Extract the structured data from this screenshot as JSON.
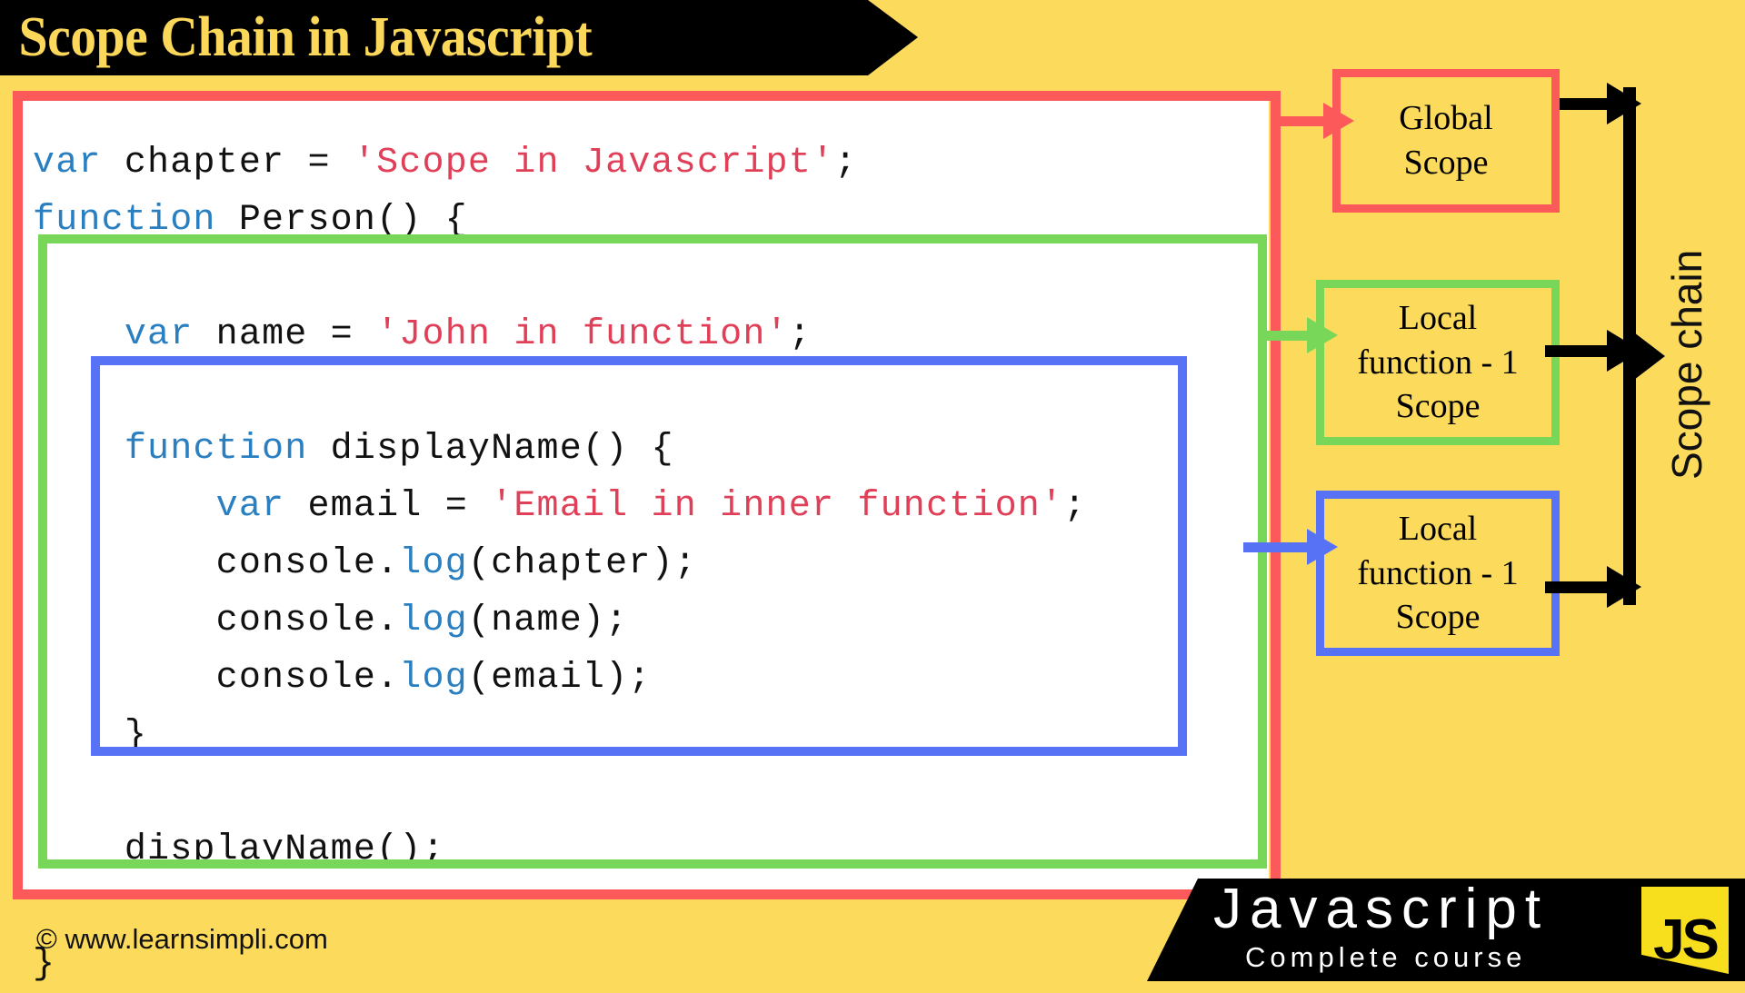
{
  "title": {
    "text": "Scope Chain in Javascript"
  },
  "code": {
    "lines": [
      [
        {
          "t": "var",
          "c": "kw"
        },
        {
          "t": " chapter = ",
          "c": "plain"
        },
        {
          "t": "'Scope in Javascript'",
          "c": "str"
        },
        {
          "t": ";",
          "c": "plain"
        }
      ],
      [
        {
          "t": "function",
          "c": "kw"
        },
        {
          "t": " Person() {",
          "c": "plain"
        }
      ],
      [
        {
          "t": "",
          "c": "plain"
        }
      ],
      [
        {
          "t": "    ",
          "c": "plain"
        },
        {
          "t": "var",
          "c": "kw"
        },
        {
          "t": " name = ",
          "c": "plain"
        },
        {
          "t": "'John in function'",
          "c": "str"
        },
        {
          "t": ";",
          "c": "plain"
        }
      ],
      [
        {
          "t": "",
          "c": "plain"
        }
      ],
      [
        {
          "t": "    ",
          "c": "plain"
        },
        {
          "t": "function",
          "c": "kw"
        },
        {
          "t": " displayName() {",
          "c": "plain"
        }
      ],
      [
        {
          "t": "        ",
          "c": "plain"
        },
        {
          "t": "var",
          "c": "kw"
        },
        {
          "t": " email = ",
          "c": "plain"
        },
        {
          "t": "'Email in inner function'",
          "c": "str"
        },
        {
          "t": ";",
          "c": "plain"
        }
      ],
      [
        {
          "t": "        console.",
          "c": "plain"
        },
        {
          "t": "log",
          "c": "meth"
        },
        {
          "t": "(chapter);",
          "c": "plain"
        }
      ],
      [
        {
          "t": "        console.",
          "c": "plain"
        },
        {
          "t": "log",
          "c": "meth"
        },
        {
          "t": "(name);",
          "c": "plain"
        }
      ],
      [
        {
          "t": "        console.",
          "c": "plain"
        },
        {
          "t": "log",
          "c": "meth"
        },
        {
          "t": "(email);",
          "c": "plain"
        }
      ],
      [
        {
          "t": "    }",
          "c": "plain"
        }
      ],
      [
        {
          "t": "",
          "c": "plain"
        }
      ],
      [
        {
          "t": "    displayName();",
          "c": "plain"
        }
      ],
      [
        {
          "t": "",
          "c": "plain"
        }
      ],
      [
        {
          "t": "}",
          "c": "plain"
        }
      ]
    ]
  },
  "scopes": {
    "global": {
      "line1": "Global",
      "line2": "Scope",
      "color": "#FC5A5A"
    },
    "local1": {
      "line1": "Local",
      "line2": "function - 1",
      "line3": "Scope",
      "color": "#78D659"
    },
    "local2": {
      "line1": "Local",
      "line2": "function - 1",
      "line3": "Scope",
      "color": "#5772F5"
    }
  },
  "chain": {
    "label": "Scope chain"
  },
  "footer": {
    "copyright": "© www.learnsimpli.com",
    "brand": "Javascript",
    "subtitle": "Complete course",
    "logo": "JS"
  },
  "colors": {
    "background": "#FCDA5C",
    "red": "#FC5A5A",
    "green": "#78D659",
    "blue": "#5772F5",
    "title_text": "#FCD85A",
    "keyword": "#2A7FC1",
    "string": "#E03F58"
  }
}
